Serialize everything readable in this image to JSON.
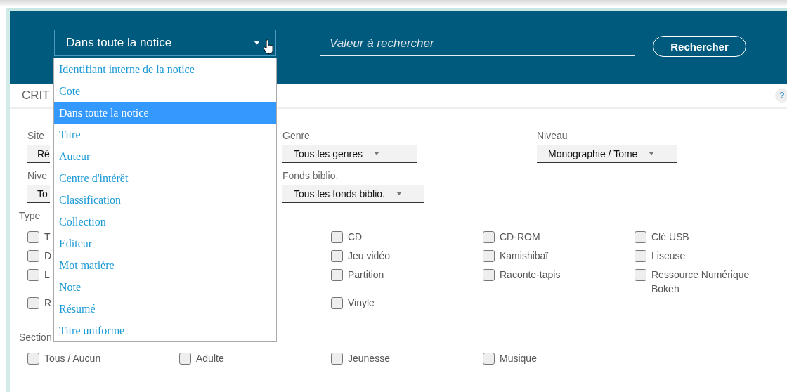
{
  "search_bar": {
    "field_select": {
      "value": "Dans toute la notice",
      "expanded": true
    },
    "search": {
      "placeholder": "Valeur à rechercher"
    },
    "button": "Rechercher"
  },
  "dropdown": {
    "options": [
      {
        "label": "Identifiant interne de la notice",
        "selected": false
      },
      {
        "label": "Cote",
        "selected": false
      },
      {
        "label": "Dans toute la notice",
        "selected": true
      },
      {
        "label": "Titre",
        "selected": false
      },
      {
        "label": "Auteur",
        "selected": false
      },
      {
        "label": "Centre d'intérêt",
        "selected": false
      },
      {
        "label": "Classification",
        "selected": false
      },
      {
        "label": "Collection",
        "selected": false
      },
      {
        "label": "Editeur",
        "selected": false
      },
      {
        "label": "Mot matière",
        "selected": false
      },
      {
        "label": "Note",
        "selected": false
      },
      {
        "label": "Résumé",
        "selected": false
      },
      {
        "label": "Titre uniforme",
        "selected": false
      }
    ]
  },
  "criteria": {
    "title": "CRIT",
    "help": "?",
    "filters": [
      [
        {
          "label": "Site",
          "value": "Ré",
          "kind": "clipped"
        },
        {
          "label": "Genre",
          "value": "Tous les genres",
          "kind": "full"
        },
        {
          "label": "Niveau",
          "value": "Monographie / Tome",
          "kind": "full"
        }
      ],
      [
        {
          "label": "Nive",
          "value": "To",
          "kind": "clipped"
        },
        {
          "label": "Fonds biblio.",
          "value": "Tous les fonds biblio.",
          "kind": "full"
        }
      ]
    ],
    "type_group": {
      "label": "Type",
      "rows": [
        [
          {
            "label": "T",
            "checked": false
          },
          null,
          {
            "label": "CD",
            "checked": false
          },
          {
            "label": "CD-ROM",
            "checked": false
          },
          {
            "label": "Clé USB",
            "checked": false
          }
        ],
        [
          {
            "label": "D",
            "checked": false
          },
          null,
          {
            "label": "Jeu vidéo",
            "checked": false
          },
          {
            "label": "Kamishibaï",
            "checked": false
          },
          {
            "label": "Liseuse",
            "checked": false
          }
        ],
        [
          {
            "label": "L",
            "checked": false
          },
          null,
          {
            "label": "Partition",
            "checked": false
          },
          {
            "label": "Raconte-tapis",
            "checked": false
          },
          {
            "label": "Ressource Numérique Bokeh",
            "checked": false
          }
        ],
        [
          {
            "label": "R",
            "checked": false
          },
          null,
          {
            "label": "Vinyle",
            "checked": false
          }
        ]
      ]
    },
    "section": {
      "label": "Section",
      "options": [
        {
          "label": "Tous / Aucun",
          "checked": false
        },
        {
          "label": "Adulte",
          "checked": false
        },
        {
          "label": "Jeunesse",
          "checked": false
        },
        {
          "label": "Musique",
          "checked": false
        }
      ]
    }
  }
}
